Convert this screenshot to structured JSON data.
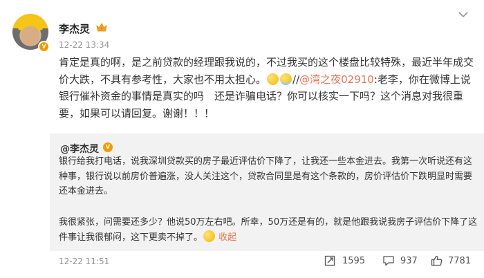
{
  "post": {
    "author": "李杰灵",
    "time": "12-22 13:34",
    "text_a": "肯定是真的啊，是之前贷款的经理跟我说的，不过我买的这个楼盘比较特殊，最近半年成交价大跌，不具有参考性，大家也不用太担心。",
    "text_sep": "//",
    "mention": "@湾之夜02910",
    "text_b": ":老李，你在微博上说银行催补资金的事情是真实的吗　还是诈骗电话？你可以核实一下吗？这个消息对我很重要，如果可以请回复。谢谢！！！"
  },
  "repost": {
    "author": "@李杰灵",
    "verified_mark": "V",
    "para1": "银行给我打电话，说我深圳贷款买的房子最近评估价下降了，让我还一些本金进去。我第一次听说还有这种事，银行说以前房价普遍涨，没人关注这个，贷款合同里是有这个条款的，房价评估价下跌明显时需要还本金进去。",
    "para2": "我很紧张，问需要还多少？他说50万左右吧。所幸，50万还是有的，就是他跟我说我房子评估价下降了这件事让我很郁闷，这下更卖不掉了。",
    "collapse_label": "收起"
  },
  "footer": {
    "time": "12-22 11:51",
    "repost_count": "1595",
    "comment_count": "937",
    "like_count": "7781"
  },
  "icons": {
    "verified": "verified-badge-icon",
    "crown": "crown-icon",
    "more": "chevron-down-icon",
    "repost": "repost-icon",
    "comment": "comment-icon",
    "like": "thumbs-up-icon"
  },
  "colors": {
    "accent": "#eb7350",
    "verified": "#f29b00",
    "repost_bg": "#f2f2f2"
  }
}
